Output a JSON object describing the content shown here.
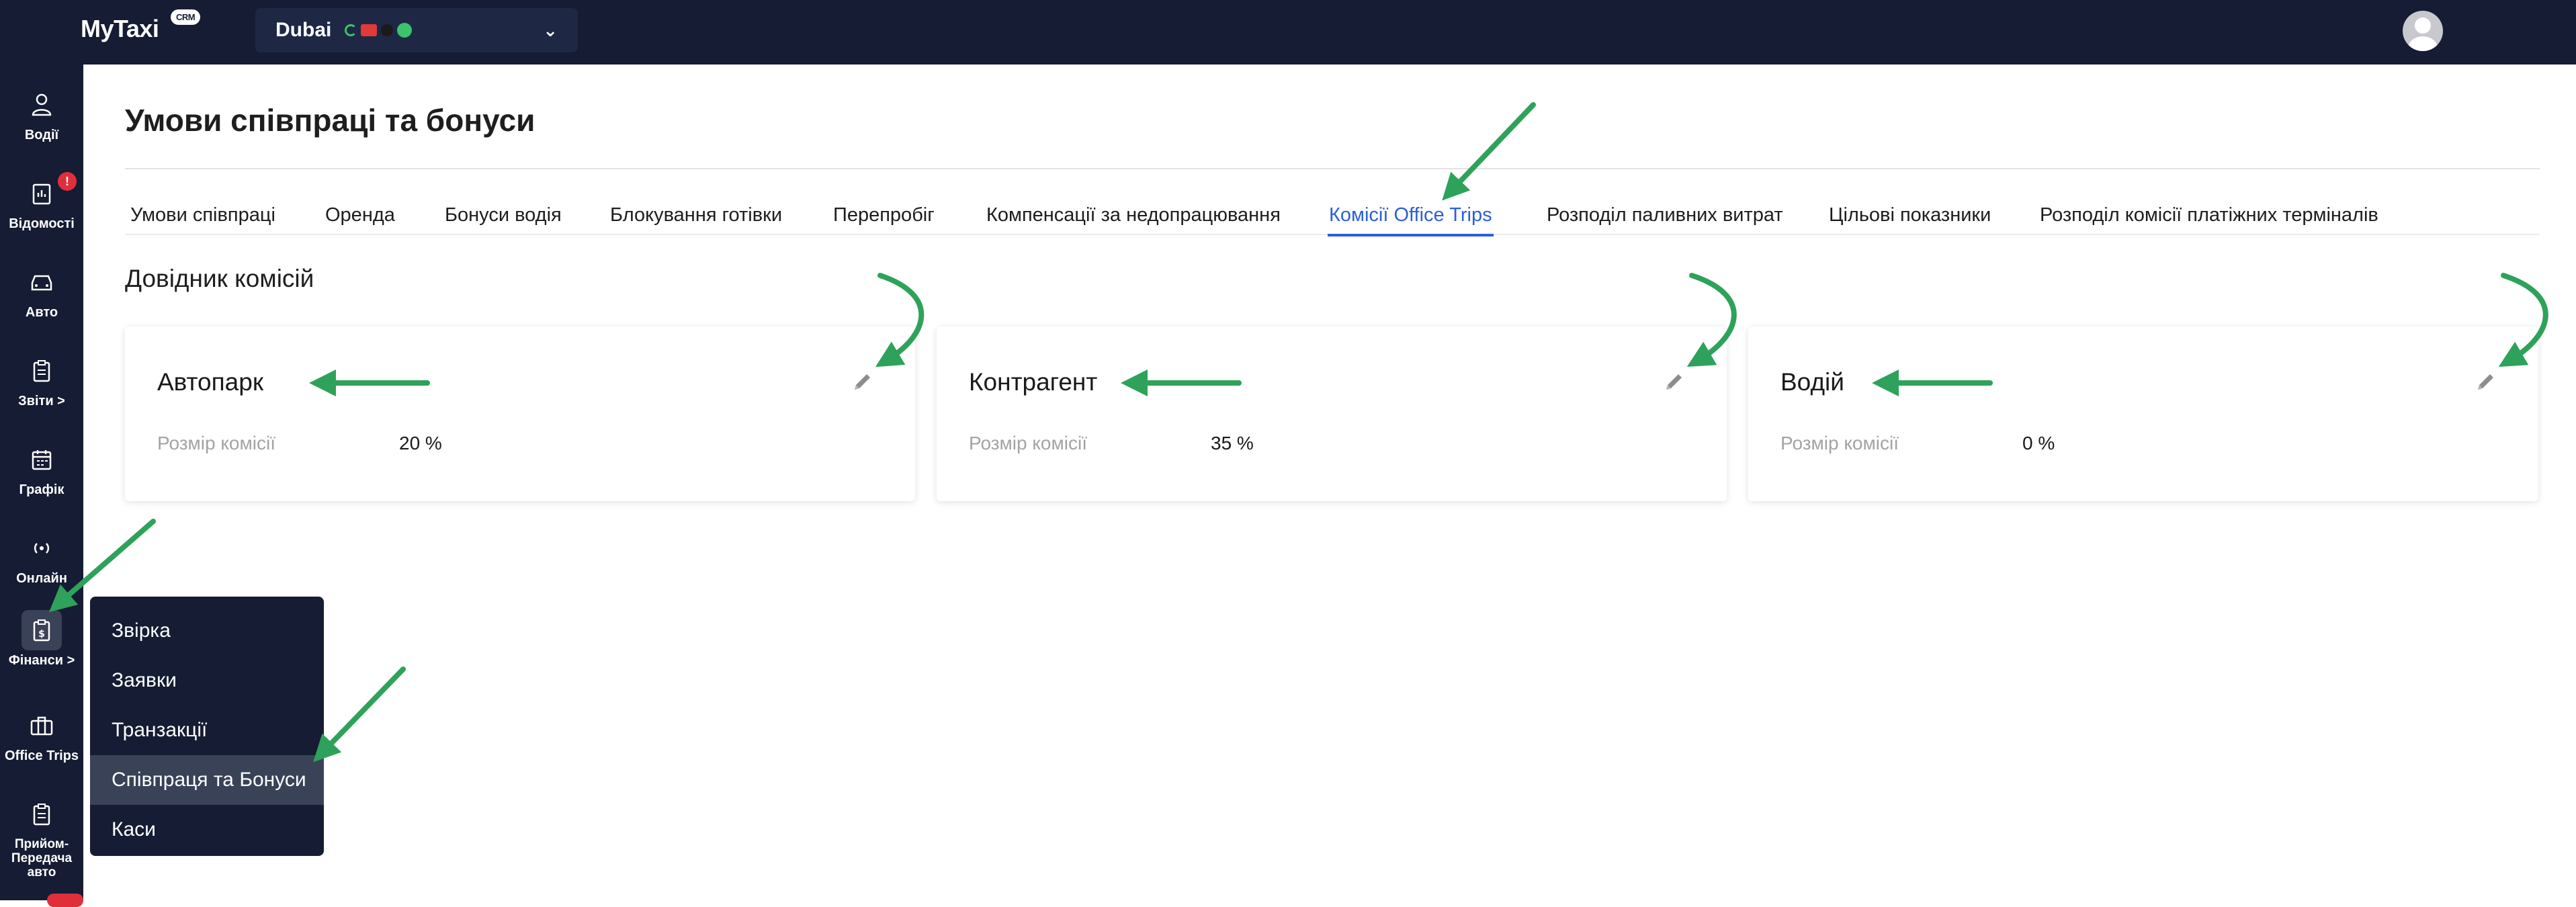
{
  "app": {
    "logo": "MyTaxi",
    "logo_badge": "CRM"
  },
  "topbar": {
    "city": "Dubai",
    "city_chevron": "chevron-down-icon",
    "avatar": "user-avatar-icon"
  },
  "sidebar": {
    "items": [
      {
        "label": "Водії",
        "icon": "person-icon"
      },
      {
        "label": "Відомості",
        "icon": "ledger-icon",
        "badge": "!"
      },
      {
        "label": "Авто",
        "icon": "car-icon"
      },
      {
        "label": "Звіти >",
        "icon": "clipboard-icon"
      },
      {
        "label": "Графік",
        "icon": "calendar-icon"
      },
      {
        "label": "Онлайн",
        "icon": "broadcast-icon"
      },
      {
        "label": "Фінанси >",
        "icon": "finance-icon"
      },
      {
        "label": "Office Trips",
        "icon": "briefcase-icon"
      },
      {
        "label": "Прийом-Передача авто",
        "icon": "clipboard-icon"
      }
    ]
  },
  "page": {
    "title": "Умови співпраці та бонуси"
  },
  "tabs": [
    "Умови співпраці",
    "Оренда",
    "Бонуси водія",
    "Блокування готівки",
    "Перепробіг",
    "Компенсації за недопрацювання",
    "Комісії Office Trips",
    "Розподіл паливних витрат",
    "Цільові показники",
    "Розподіл комісії платіжних терміналів"
  ],
  "active_tab": "Комісії Office Trips",
  "section": {
    "title": "Довідник комісій"
  },
  "cards": [
    {
      "title": "Автопарк",
      "label": "Розмір комісії",
      "value": "20 %"
    },
    {
      "title": "Контрагент",
      "label": "Розмір комісії",
      "value": "35 %"
    },
    {
      "title": "Водій",
      "label": "Розмір комісії",
      "value": "0 %"
    }
  ],
  "submenu": {
    "items": [
      "Звірка",
      "Заявки",
      "Транзакції",
      "Співпраця та Бонуси",
      "Каси"
    ],
    "active": "Співпраця та Бонуси"
  },
  "colors": {
    "nav_bg": "#151c33",
    "active_tab": "#2b5ed8",
    "annotation_arrow": "#2ea25a",
    "badge": "#e02f3b"
  }
}
